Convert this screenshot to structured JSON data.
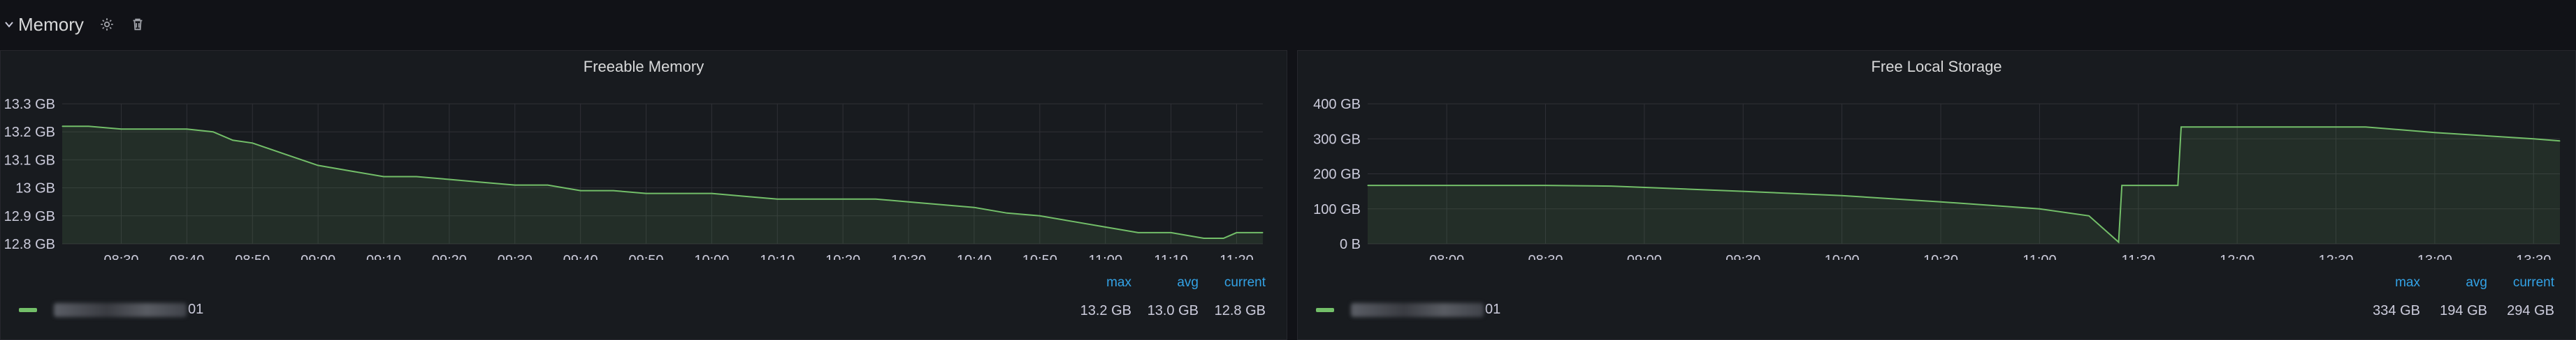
{
  "row": {
    "title": "Memory",
    "icons": [
      "chevron-down-icon",
      "gear-icon",
      "trash-icon"
    ]
  },
  "colors": {
    "series": "#73bf69",
    "grid": "#2f3036",
    "legend_header": "#33a2e5",
    "text": "#ccccdc"
  },
  "panels": [
    {
      "title": "Freeable Memory",
      "legend": {
        "series_suffix": "01",
        "headers": {
          "max": "max",
          "avg": "avg",
          "current": "current"
        },
        "values": {
          "max": "13.2 GB",
          "avg": "13.0 GB",
          "current": "12.8 GB"
        }
      }
    },
    {
      "title": "Free Local Storage",
      "legend": {
        "series_suffix": "01",
        "headers": {
          "max": "max",
          "avg": "avg",
          "current": "current"
        },
        "values": {
          "max": "334 GB",
          "avg": "194 GB",
          "current": "294 GB"
        }
      }
    }
  ],
  "chart_data": [
    {
      "type": "area",
      "title": "Freeable Memory",
      "unit": "GB",
      "x_ticks": [
        "08:30",
        "08:40",
        "08:50",
        "09:00",
        "09:10",
        "09:20",
        "09:30",
        "09:40",
        "09:50",
        "10:00",
        "10:10",
        "10:20",
        "10:30",
        "10:40",
        "10:50",
        "11:00",
        "11:10",
        "11:20"
      ],
      "y_ticks": [
        "12.8 GB",
        "12.9 GB",
        "13 GB",
        "13.1 GB",
        "13.2 GB",
        "13.3 GB"
      ],
      "ylim": [
        12.8,
        13.3
      ],
      "xlim": [
        "08:21",
        "11:24"
      ],
      "grid": true,
      "series": [
        {
          "color": "#73bf69",
          "points": [
            [
              "08:21",
              13.22
            ],
            [
              "08:25",
              13.22
            ],
            [
              "08:30",
              13.21
            ],
            [
              "08:35",
              13.21
            ],
            [
              "08:40",
              13.21
            ],
            [
              "08:44",
              13.2
            ],
            [
              "08:47",
              13.17
            ],
            [
              "08:50",
              13.16
            ],
            [
              "08:55",
              13.12
            ],
            [
              "09:00",
              13.08
            ],
            [
              "09:05",
              13.06
            ],
            [
              "09:10",
              13.04
            ],
            [
              "09:15",
              13.04
            ],
            [
              "09:20",
              13.03
            ],
            [
              "09:25",
              13.02
            ],
            [
              "09:30",
              13.01
            ],
            [
              "09:35",
              13.01
            ],
            [
              "09:40",
              12.99
            ],
            [
              "09:45",
              12.99
            ],
            [
              "09:50",
              12.98
            ],
            [
              "09:55",
              12.98
            ],
            [
              "10:00",
              12.98
            ],
            [
              "10:05",
              12.97
            ],
            [
              "10:10",
              12.96
            ],
            [
              "10:15",
              12.96
            ],
            [
              "10:20",
              12.96
            ],
            [
              "10:25",
              12.96
            ],
            [
              "10:30",
              12.95
            ],
            [
              "10:35",
              12.94
            ],
            [
              "10:40",
              12.93
            ],
            [
              "10:45",
              12.91
            ],
            [
              "10:50",
              12.9
            ],
            [
              "10:55",
              12.88
            ],
            [
              "11:00",
              12.86
            ],
            [
              "11:05",
              12.84
            ],
            [
              "11:10",
              12.84
            ],
            [
              "11:15",
              12.82
            ],
            [
              "11:18",
              12.82
            ],
            [
              "11:20",
              12.84
            ],
            [
              "11:24",
              12.84
            ]
          ]
        }
      ]
    },
    {
      "type": "area",
      "title": "Free Local Storage",
      "unit": "GB",
      "x_ticks": [
        "08:00",
        "08:30",
        "09:00",
        "09:30",
        "10:00",
        "10:30",
        "11:00",
        "11:30",
        "12:00",
        "12:30",
        "13:00",
        "13:30"
      ],
      "y_ticks": [
        "0 B",
        "100 GB",
        "200 GB",
        "300 GB",
        "400 GB"
      ],
      "ylim": [
        0,
        400
      ],
      "xlim": [
        "07:36",
        "13:38"
      ],
      "grid": true,
      "series": [
        {
          "color": "#73bf69",
          "points": [
            [
              "07:36",
              167
            ],
            [
              "08:30",
              167
            ],
            [
              "08:50",
              165
            ],
            [
              "09:30",
              150
            ],
            [
              "10:00",
              138
            ],
            [
              "10:30",
              120
            ],
            [
              "11:00",
              100
            ],
            [
              "11:15",
              80
            ],
            [
              "11:24",
              5
            ],
            [
              "11:25",
              167
            ],
            [
              "11:42",
              167
            ],
            [
              "11:43",
              334
            ],
            [
              "12:39",
              334
            ],
            [
              "13:00",
              318
            ],
            [
              "13:30",
              300
            ],
            [
              "13:38",
              294
            ]
          ]
        }
      ]
    }
  ]
}
